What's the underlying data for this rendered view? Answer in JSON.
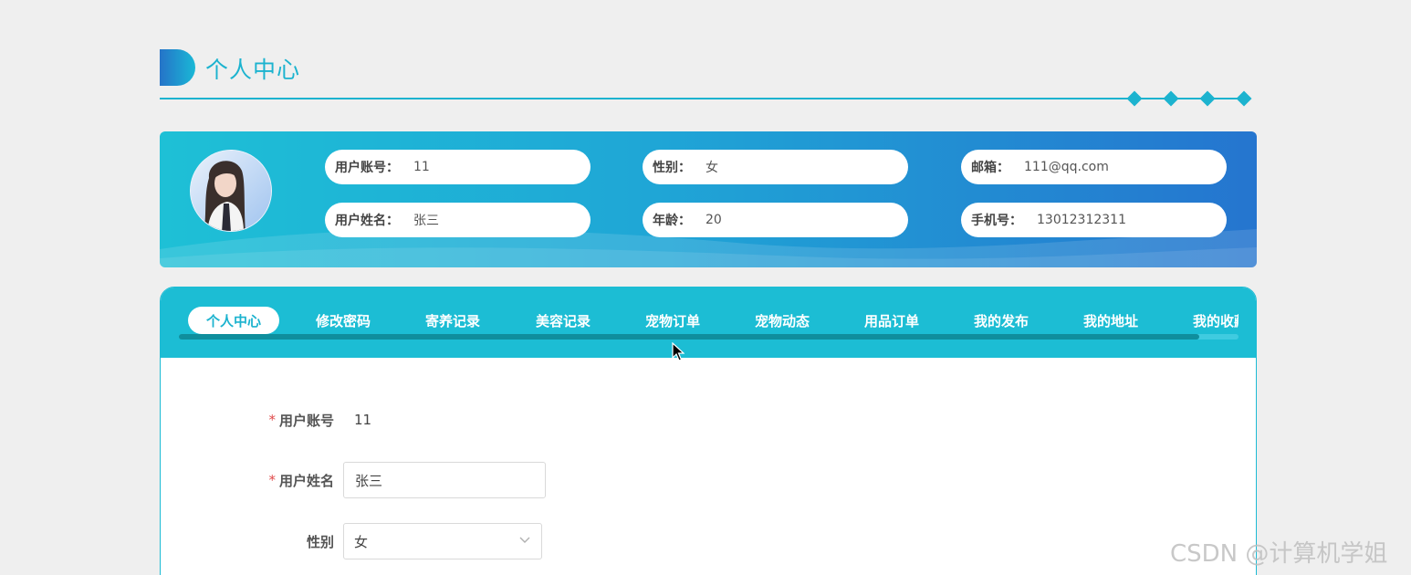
{
  "page": {
    "title": "个人中心"
  },
  "profile": {
    "fields": [
      {
        "key": "用户账号：",
        "value": "11"
      },
      {
        "key": "性别：",
        "value": "女"
      },
      {
        "key": "邮箱：",
        "value": "111@qq.com"
      },
      {
        "key": "用户姓名：",
        "value": "张三"
      },
      {
        "key": "年龄：",
        "value": "20"
      },
      {
        "key": "手机号：",
        "value": "13012312311"
      }
    ]
  },
  "tabs": [
    {
      "label": "个人中心",
      "active": true
    },
    {
      "label": "修改密码"
    },
    {
      "label": "寄养记录"
    },
    {
      "label": "美容记录"
    },
    {
      "label": "宠物订单"
    },
    {
      "label": "宠物动态"
    },
    {
      "label": "用品订单"
    },
    {
      "label": "我的发布"
    },
    {
      "label": "我的地址"
    },
    {
      "label": "我的收藏"
    }
  ],
  "form": {
    "required_mark": "*",
    "account": {
      "label": "用户账号",
      "value": "11"
    },
    "name": {
      "label": "用户姓名",
      "value": "张三"
    },
    "gender": {
      "label": "性别",
      "value": "女"
    }
  },
  "watermark": "CSDN @计算机学姐",
  "colors": {
    "accent": "#1cb3cf",
    "tabbar": "#1cbdd4",
    "banner_end": "#2575cf"
  }
}
